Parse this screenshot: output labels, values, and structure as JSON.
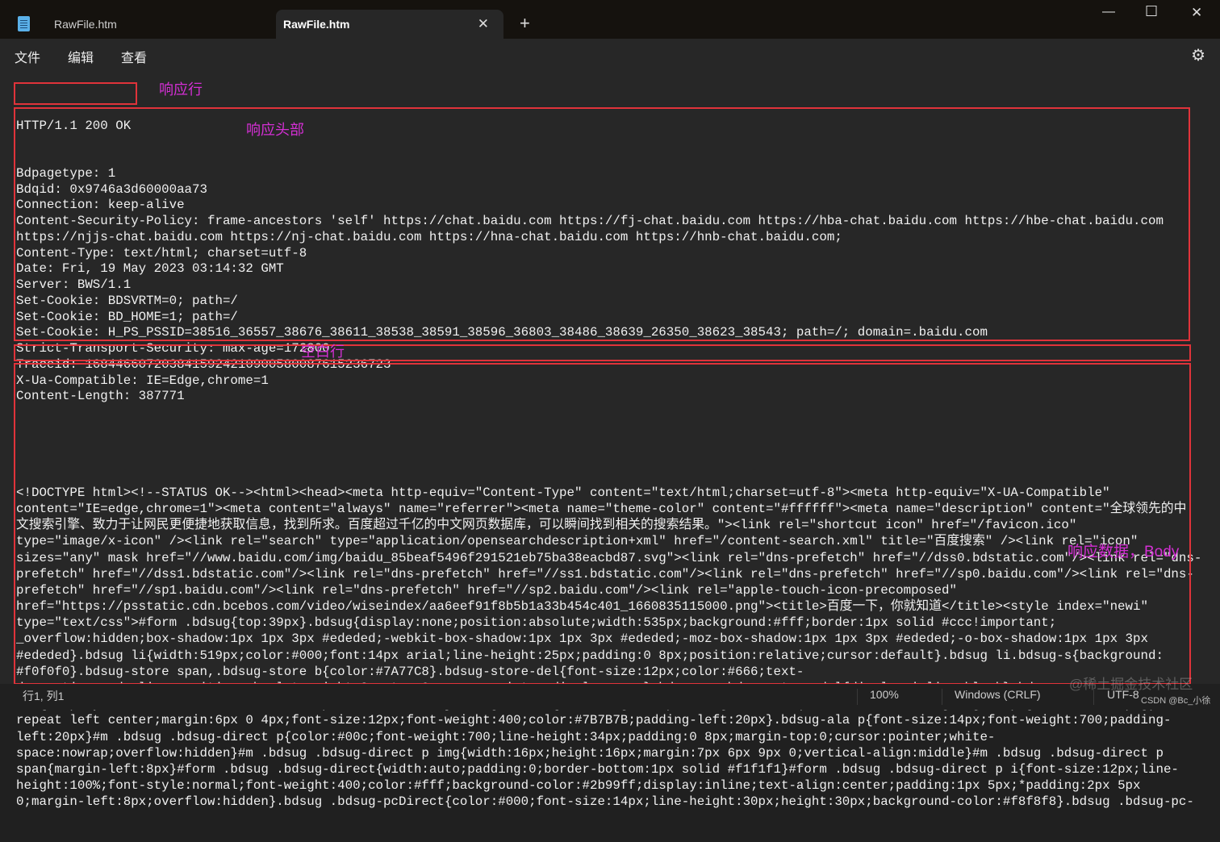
{
  "window": {
    "tabs": [
      {
        "label": "RawFile.htm",
        "active": false
      },
      {
        "label": "RawFile.htm",
        "active": true
      }
    ],
    "new_tab": "+",
    "close_tab": "✕",
    "minimize": "—",
    "maximize": "☐",
    "close": "✕"
  },
  "menu": {
    "items": [
      "文件",
      "编辑",
      "查看"
    ],
    "settings": "⚙"
  },
  "status_line": "HTTP/1.1 200 OK",
  "headers": [
    "Bdpagetype: 1",
    "Bdqid: 0x9746a3d60000aa73",
    "Connection: keep-alive",
    "Content-Security-Policy: frame-ancestors 'self' https://chat.baidu.com https://fj-chat.baidu.com https://hba-chat.baidu.com https://hbe-chat.baidu.com",
    "https://njjs-chat.baidu.com https://nj-chat.baidu.com https://hna-chat.baidu.com https://hnb-chat.baidu.com;",
    "Content-Type: text/html; charset=utf-8",
    "Date: Fri, 19 May 2023 03:14:32 GMT",
    "Server: BWS/1.1",
    "Set-Cookie: BDSVRTM=0; path=/",
    "Set-Cookie: BD_HOME=1; path=/",
    "Set-Cookie: H_PS_PSSID=38516_36557_38676_38611_38538_38591_38596_36803_38486_38639_26350_38623_38543; path=/; domain=.baidu.com",
    "Strict-Transport-Security: max-age=172800",
    "Traceid: 1684466072038415924210900580087615236723",
    "X-Ua-Compatible: IE=Edge,chrome=1",
    "Content-Length: 387771"
  ],
  "body_lines": [
    "<!DOCTYPE html><!--STATUS OK--><html><head><meta http-equiv=\"Content-Type\" content=\"text/html;charset=utf-8\"><meta http-equiv=\"X-UA-Compatible\"",
    "content=\"IE=edge,chrome=1\"><meta content=\"always\" name=\"referrer\"><meta name=\"theme-color\" content=\"#ffffff\"><meta name=\"description\" content=\"全球领先的中",
    "文搜索引擎、致力于让网民更便捷地获取信息，找到所求。百度超过千亿的中文网页数据库，可以瞬间找到相关的搜索结果。\"><link rel=\"shortcut icon\" href=\"/favicon.ico\"",
    "type=\"image/x-icon\" /><link rel=\"search\" type=\"application/opensearchdescription+xml\" href=\"/content-search.xml\" title=\"百度搜索\" /><link rel=\"icon\"",
    "sizes=\"any\" mask href=\"//www.baidu.com/img/baidu_85beaf5496f291521eb75ba38eacbd87.svg\"><link rel=\"dns-prefetch\" href=\"//dss0.bdstatic.com\"/><link rel=\"dns-",
    "prefetch\" href=\"//dss1.bdstatic.com\"/><link rel=\"dns-prefetch\" href=\"//ss1.bdstatic.com\"/><link rel=\"dns-prefetch\" href=\"//sp0.baidu.com\"/><link rel=\"dns-",
    "prefetch\" href=\"//sp1.baidu.com\"/><link rel=\"dns-prefetch\" href=\"//sp2.baidu.com\"/><link rel=\"apple-touch-icon-precomposed\"",
    "href=\"https://psstatic.cdn.bcebos.com/video/wiseindex/aa6eef91f8b5b1a33b454c401_1660835115000.png\"><title>百度一下，你就知道</title><style index=\"newi\"",
    "type=\"text/css\">#form .bdsug{top:39px}.bdsug{display:none;position:absolute;width:535px;background:#fff;border:1px solid #ccc!important;",
    "_overflow:hidden;box-shadow:1px 1px 3px #ededed;-webkit-box-shadow:1px 1px 3px #ededed;-moz-box-shadow:1px 1px 3px #ededed;-o-box-shadow:1px 1px 3px",
    "#ededed}.bdsug li{width:519px;color:#000;font:14px arial;line-height:25px;padding:0 8px;position:relative;cursor:default}.bdsug li.bdsug-s{background:",
    "#f0f0f0}.bdsug-store span,.bdsug-store b{color:#7A77C8}.bdsug-store-del{font-size:12px;color:#666;text-",
    "decoration:underline;position:absolute;right:8px;top:0;cursor:pointer;display:none}.bdsug-s .bdsug-store-del{display:inline-block}.bdsug-",
    "ala{display:inline-block;border-bottom:1px solid #e6e6e6}.bdsug-ala h3{line-height:14px;background:url(//www.baidu.com/img/sug_bd.png?v=09816787.png) no-",
    "repeat left center;margin:6px 0 4px;font-size:12px;font-weight:400;color:#7B7B7B;padding-left:20px}.bdsug-ala p{font-size:14px;font-weight:700;padding-",
    "left:20px}#m .bdsug .bdsug-direct p{color:#00c;font-weight:700;line-height:34px;padding:0 8px;margin-top:0;cursor:pointer;white-",
    "space:nowrap;overflow:hidden}#m .bdsug .bdsug-direct p img{width:16px;height:16px;margin:7px 6px 9px 0;vertical-align:middle}#m .bdsug .bdsug-direct p",
    "span{margin-left:8px}#form .bdsug .bdsug-direct{width:auto;padding:0;border-bottom:1px solid #f1f1f1}#form .bdsug .bdsug-direct p i{font-size:12px;line-",
    "height:100%;font-style:normal;font-weight:400;color:#fff;background-color:#2b99ff;display:inline;text-align:center;padding:1px 5px;*padding:2px 5px",
    "0;margin-left:8px;overflow:hidden}.bdsug .bdsug-pcDirect{color:#000;font-size:14px;line-height:30px;height:30px;background-color:#f8f8f8}.bdsug .bdsug-pc-"
  ],
  "annotations": {
    "status_line": "响应行",
    "headers": "响应头部",
    "blank_line": "空白行",
    "body": "响应数据，Body",
    "color": "#d42fd4",
    "box_color": "#e0333a"
  },
  "statusbar": {
    "position": "行1, 列1",
    "zoom": "100%",
    "line_ending": "Windows (CRLF)",
    "encoding": "UTF-8"
  },
  "watermark": {
    "juejin": "@稀土掘金技术社区",
    "csdn": "CSDN @Bc_小徐"
  }
}
